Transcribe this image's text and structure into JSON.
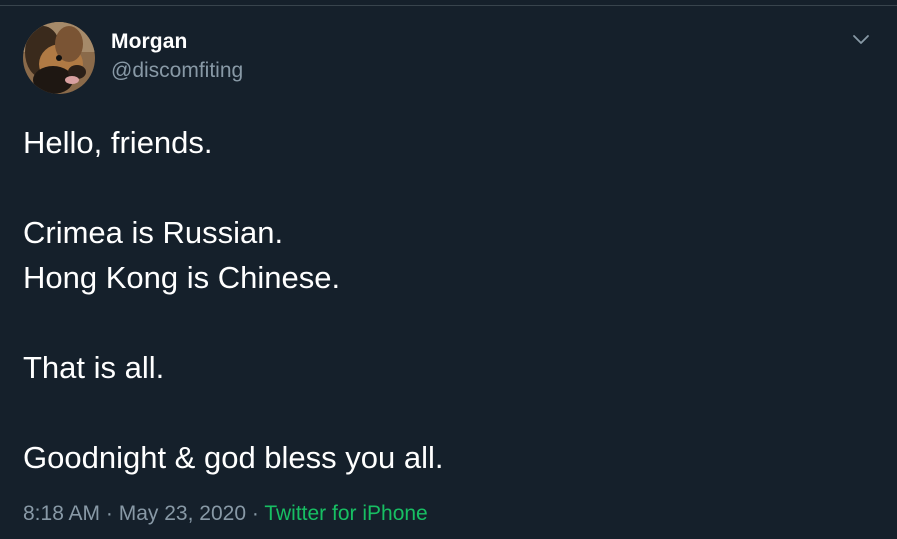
{
  "tweet": {
    "author": {
      "display_name": "Morgan",
      "handle": "@discomfiting",
      "avatar_icon": "dog-avatar"
    },
    "menu_icon": "chevron-down-icon",
    "lines": [
      "Hello, friends.",
      "",
      "Crimea is Russian.",
      "Hong Kong is Chinese.",
      "",
      "That is all.",
      "",
      "Goodnight & god bless you all."
    ],
    "time": "8:18 AM",
    "separator": "·",
    "date": "May 23, 2020",
    "source": "Twitter for iPhone"
  },
  "colors": {
    "background": "#15202b",
    "text": "#ffffff",
    "secondary": "#8899a6",
    "source_link": "#17bf63"
  }
}
